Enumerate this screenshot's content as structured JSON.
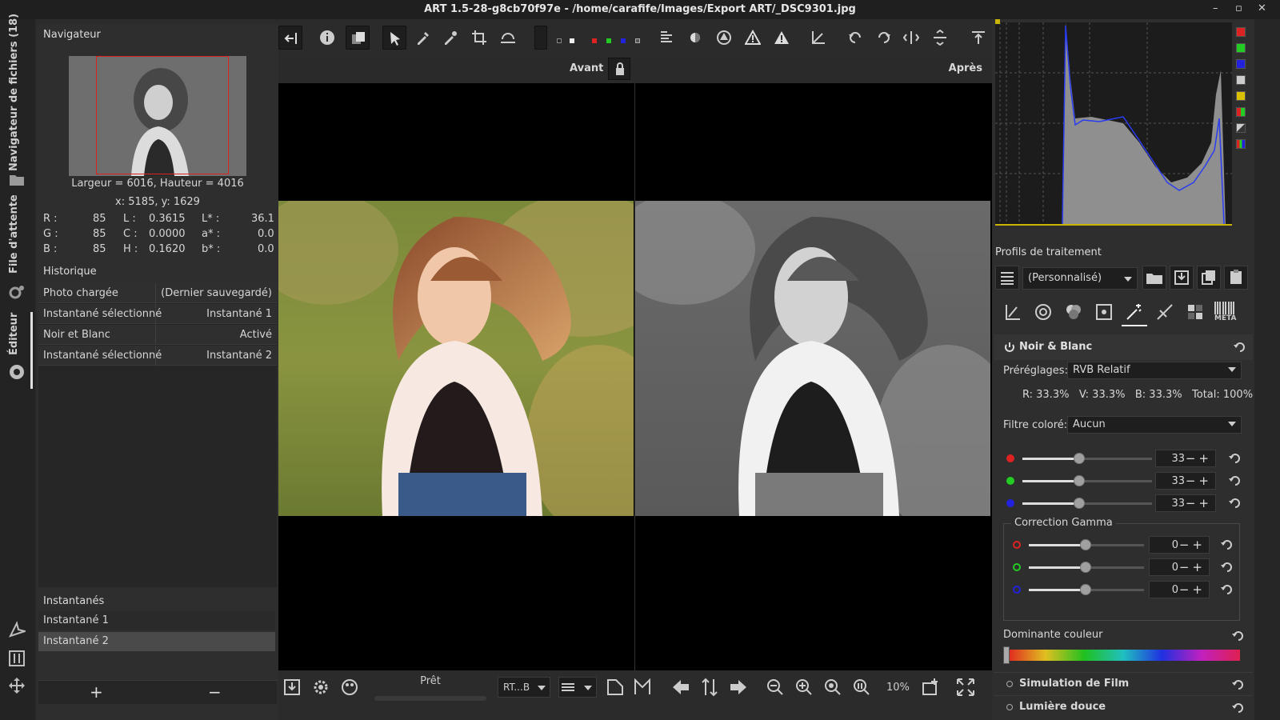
{
  "window": {
    "title": "ART 1.5-28-g8cb70f97e - /home/carafife/Images/Export ART/_DSC9301.jpg"
  },
  "left_tabs": {
    "file_browser": "Navigateur de fichiers (18)",
    "queue": "File d'attente",
    "editor": "Éditeur"
  },
  "navigator": {
    "title": "Navigateur",
    "size": "Largeur = 6016, Hauteur = 4016",
    "coords": "x: 5185, y: 1629",
    "pixel": {
      "r_label": "R :",
      "r": "85",
      "g_label": "G :",
      "g": "85",
      "b_label": "B :",
      "b": "85",
      "l_label": "L :",
      "l": "0.3615",
      "c_label": "C :",
      "c": "0.0000",
      "h_label": "H :",
      "h": "0.1620",
      "ls_label": "L* :",
      "ls": "36.1",
      "as_label": "a* :",
      "as": "0.0",
      "bs_label": "b* :",
      "bs": "0.0"
    }
  },
  "history": {
    "title": "Historique",
    "rows": [
      {
        "name": "Photo chargée",
        "value": "(Dernier sauvegardé)"
      },
      {
        "name": "Instantané sélectionné",
        "value": "Instantané 1"
      },
      {
        "name": "Noir et Blanc",
        "value": "Activé"
      },
      {
        "name": "Instantané sélectionné",
        "value": "Instantané 2"
      }
    ]
  },
  "snapshots": {
    "title": "Instantanés",
    "items": [
      "Instantané 1",
      "Instantané 2"
    ],
    "add": "+",
    "remove": "−"
  },
  "view": {
    "before": "Avant",
    "after": "Après"
  },
  "bottombar": {
    "status": "Prêt",
    "profile_short": "RT...B",
    "zoom": "10%"
  },
  "profiles": {
    "title": "Profils de traitement",
    "current": "(Personnalisé)"
  },
  "bw": {
    "title": "Noir & Blanc",
    "presets_label": "Préréglages:",
    "presets_value": "RVB Relatif",
    "mix": "R: 33.3%   V: 33.3%   B: 33.3%   Total: 100%",
    "filter_label": "Filtre coloré:",
    "filter_value": "Aucun",
    "channels": [
      {
        "value": "33"
      },
      {
        "value": "33"
      },
      {
        "value": "33"
      }
    ],
    "gamma_title": "Correction Gamma",
    "gamma": [
      {
        "value": "0"
      },
      {
        "value": "0"
      },
      {
        "value": "0"
      }
    ],
    "tint_title": "Dominante couleur"
  },
  "other_tools": {
    "film": "Simulation de Film",
    "soft": "Lumière douce",
    "meta": "META"
  },
  "colors": {
    "accent_red": "#d22222",
    "hist_yellow": "#c9b500",
    "hist_blue": "#2a3cf0"
  }
}
